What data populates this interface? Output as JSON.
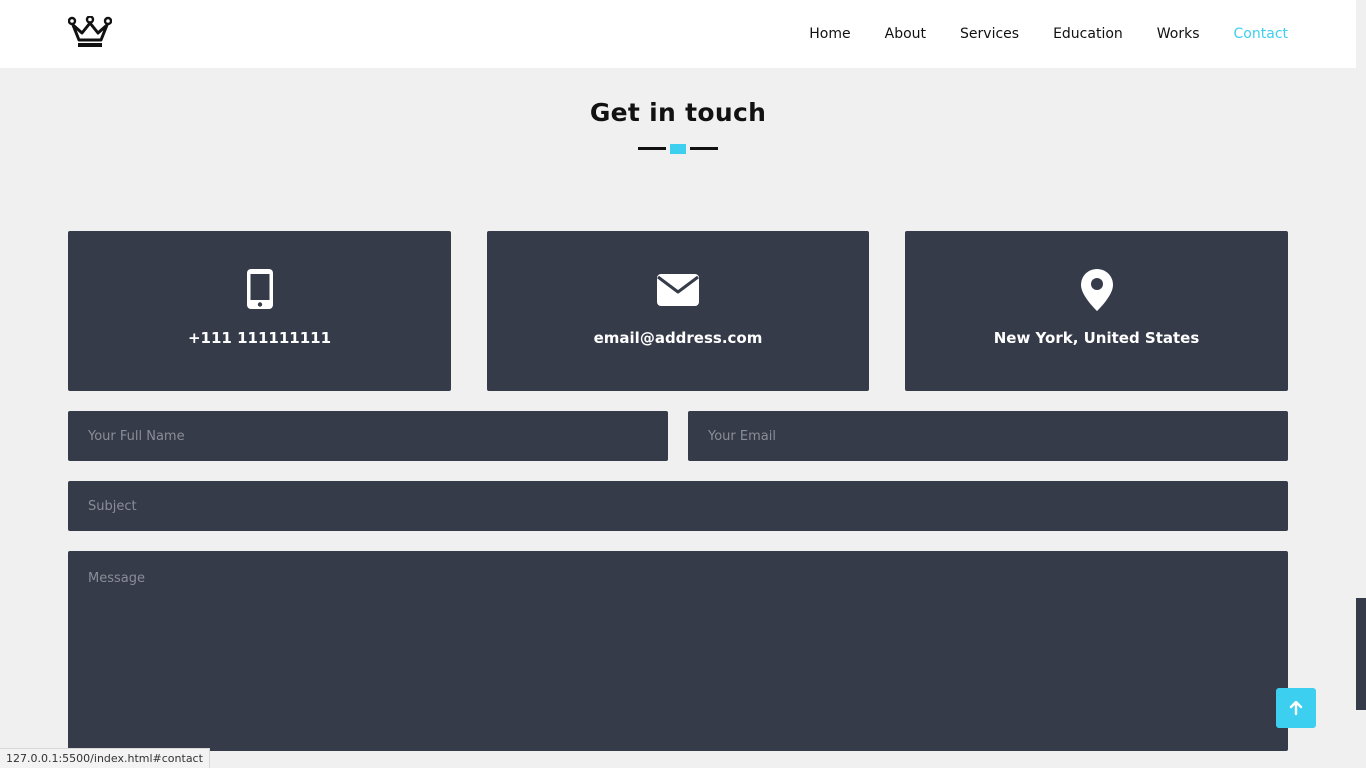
{
  "nav": {
    "logo_icon": "crown-icon",
    "items": [
      {
        "label": "Home"
      },
      {
        "label": "About"
      },
      {
        "label": "Services"
      },
      {
        "label": "Education"
      },
      {
        "label": "Works"
      },
      {
        "label": "Contact",
        "active": true
      }
    ]
  },
  "section": {
    "title": "Get in touch"
  },
  "contact_cards": [
    {
      "icon": "mobile-phone-icon",
      "text": "+111 111111111"
    },
    {
      "icon": "envelope-icon",
      "text": "email@address.com"
    },
    {
      "icon": "map-marker-icon",
      "text": "New York, United States"
    }
  ],
  "form": {
    "name_placeholder": "Your Full Name",
    "email_placeholder": "Your Email",
    "subject_placeholder": "Subject",
    "message_placeholder": "Message"
  },
  "back_to_top_icon": "arrow-up-icon",
  "status_bar": {
    "url": "127.0.0.1:5500/index.html#contact"
  },
  "colors": {
    "accent": "#3dcfef",
    "card_bg": "#363b4a",
    "page_bg": "#f0f0f0"
  }
}
